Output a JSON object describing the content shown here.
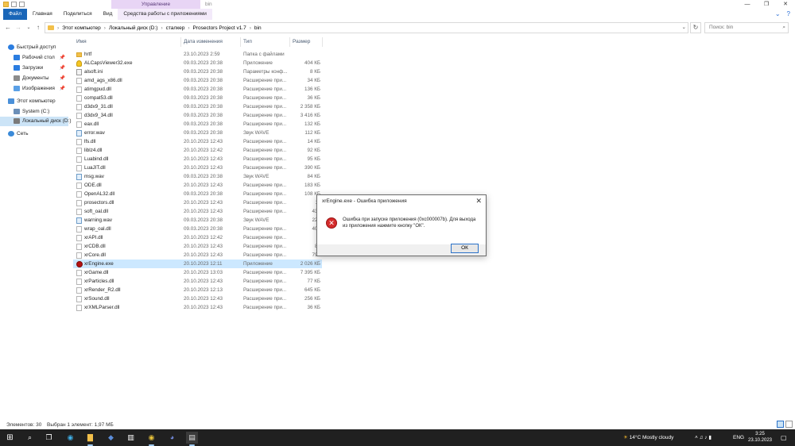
{
  "window": {
    "title": "bin",
    "context_tab": "Управление",
    "controls": [
      "—",
      "❐",
      "✕"
    ]
  },
  "ribbon": {
    "tabs": [
      "Файл",
      "Главная",
      "Поделиться",
      "Вид",
      "Средства работы с приложениями"
    ],
    "right_icons": [
      "chevron-down-icon",
      "help-icon"
    ]
  },
  "address": {
    "path": [
      "Этот компьютер",
      "Локальный диск (D:)",
      "сталкер",
      "Prosectors Project v1.7",
      "bin"
    ],
    "search_placeholder": "Поиск: bin"
  },
  "sidebar": {
    "items": [
      {
        "label": "Быстрый доступ",
        "icon": "star-icon",
        "color": "#2b7de0",
        "pinned": false,
        "indent": 0
      },
      {
        "label": "Рабочий стол",
        "icon": "desktop-icon",
        "color": "#2b7de0",
        "pinned": true,
        "indent": 1
      },
      {
        "label": "Загрузки",
        "icon": "download-icon",
        "color": "#2b7de0",
        "pinned": true,
        "indent": 1
      },
      {
        "label": "Документы",
        "icon": "documents-icon",
        "color": "#8c8c8c",
        "pinned": true,
        "indent": 1
      },
      {
        "label": "Изображения",
        "icon": "pictures-icon",
        "color": "#5aa0e6",
        "pinned": true,
        "indent": 1
      },
      {
        "label": "Этот компьютер",
        "icon": "computer-icon",
        "color": "#4a90d9",
        "pinned": false,
        "indent": 0
      },
      {
        "label": "System (C:)",
        "icon": "drive-icon",
        "color": "#6b8fb8",
        "pinned": false,
        "indent": 1
      },
      {
        "label": "Локальный диск (D:)",
        "icon": "drive-icon",
        "color": "#7a7a7a",
        "pinned": false,
        "indent": 1
      },
      {
        "label": "Сеть",
        "icon": "network-icon",
        "color": "#3b8ad8",
        "pinned": false,
        "indent": 0
      }
    ]
  },
  "columns": {
    "name": "Имя",
    "date": "Дата изменения",
    "type": "Тип",
    "size": "Размер"
  },
  "files": [
    {
      "name": "hrtf",
      "date": "23.10.2023 2:59",
      "type": "Папка с файлами",
      "size": "",
      "icon": "folder"
    },
    {
      "name": "ALCapsViewer32.exe",
      "date": "09.03.2023 20:38",
      "type": "Приложение",
      "size": "404 КБ",
      "icon": "yellow"
    },
    {
      "name": "alsoft.ini",
      "date": "09.03.2023 20:38",
      "type": "Параметры конф...",
      "size": "8 КБ",
      "icon": "ini"
    },
    {
      "name": "amd_ags_x86.dll",
      "date": "09.03.2023 20:38",
      "type": "Расширение при...",
      "size": "34 КБ",
      "icon": "dll"
    },
    {
      "name": "atimgpud.dll",
      "date": "09.03.2023 20:38",
      "type": "Расширение при...",
      "size": "136 КБ",
      "icon": "dll"
    },
    {
      "name": "compat53.dll",
      "date": "09.03.2023 20:38",
      "type": "Расширение при...",
      "size": "36 КБ",
      "icon": "dll"
    },
    {
      "name": "d3dx9_31.dll",
      "date": "09.03.2023 20:38",
      "type": "Расширение при...",
      "size": "2 358 КБ",
      "icon": "dll"
    },
    {
      "name": "d3dx9_34.dll",
      "date": "09.03.2023 20:38",
      "type": "Расширение при...",
      "size": "3 416 КБ",
      "icon": "dll"
    },
    {
      "name": "eax.dll",
      "date": "09.03.2023 20:38",
      "type": "Расширение при...",
      "size": "132 КБ",
      "icon": "dll"
    },
    {
      "name": "error.wav",
      "date": "09.03.2023 20:38",
      "type": "Звук WAVE",
      "size": "112 КБ",
      "icon": "wav"
    },
    {
      "name": "lfs.dll",
      "date": "20.10.2023 12:43",
      "type": "Расширение при...",
      "size": "14 КБ",
      "icon": "dll"
    },
    {
      "name": "liblz4.dll",
      "date": "20.10.2023 12:42",
      "type": "Расширение при...",
      "size": "92 КБ",
      "icon": "dll"
    },
    {
      "name": "Luabind.dll",
      "date": "20.10.2023 12:43",
      "type": "Расширение при...",
      "size": "95 КБ",
      "icon": "dll"
    },
    {
      "name": "LuaJIT.dll",
      "date": "20.10.2023 12:43",
      "type": "Расширение при...",
      "size": "390 КБ",
      "icon": "dll"
    },
    {
      "name": "msg.wav",
      "date": "09.03.2023 20:38",
      "type": "Звук WAVE",
      "size": "84 КБ",
      "icon": "wav"
    },
    {
      "name": "ODE.dll",
      "date": "20.10.2023 12:43",
      "type": "Расширение при...",
      "size": "183 КБ",
      "icon": "dll"
    },
    {
      "name": "OpenAL32.dll",
      "date": "09.03.2023 20:38",
      "type": "Расширение при...",
      "size": "108 КБ",
      "icon": "dll"
    },
    {
      "name": "prosectors.dll",
      "date": "20.10.2023 12:43",
      "type": "Расширение при...",
      "size": "11",
      "icon": "dll"
    },
    {
      "name": "soft_oal.dll",
      "date": "20.10.2023 12:43",
      "type": "Расширение при...",
      "size": "435",
      "icon": "dll"
    },
    {
      "name": "warning.wav",
      "date": "09.03.2023 20:38",
      "type": "Звук WAVE",
      "size": "223",
      "icon": "wav"
    },
    {
      "name": "wrap_oal.dll",
      "date": "09.03.2023 20:38",
      "type": "Расширение при...",
      "size": "404",
      "icon": "dll"
    },
    {
      "name": "xrAPI.dll",
      "date": "20.10.2023 12:42",
      "type": "Расширение при...",
      "size": "7",
      "icon": "dll"
    },
    {
      "name": "xrCDB.dll",
      "date": "20.10.2023 12:43",
      "type": "Расширение при...",
      "size": "84",
      "icon": "dll"
    },
    {
      "name": "xrCore.dll",
      "date": "20.10.2023 12:43",
      "type": "Расширение при...",
      "size": "794",
      "icon": "dll"
    },
    {
      "name": "xrEngine.exe",
      "date": "20.10.2023 12:11",
      "type": "Приложение",
      "size": "2 026 КБ",
      "icon": "red",
      "selected": true
    },
    {
      "name": "xrGame.dll",
      "date": "20.10.2023 13:03",
      "type": "Расширение при...",
      "size": "7 395 КБ",
      "icon": "dll"
    },
    {
      "name": "xrParticles.dll",
      "date": "20.10.2023 12:43",
      "type": "Расширение при...",
      "size": "77 КБ",
      "icon": "dll"
    },
    {
      "name": "xrRender_R2.dll",
      "date": "20.10.2023 12:13",
      "type": "Расширение при...",
      "size": "645 КБ",
      "icon": "dll"
    },
    {
      "name": "xrSound.dll",
      "date": "20.10.2023 12:43",
      "type": "Расширение при...",
      "size": "256 КБ",
      "icon": "dll"
    },
    {
      "name": "xrXMLParser.dll",
      "date": "20.10.2023 12:43",
      "type": "Расширение при...",
      "size": "36 КБ",
      "icon": "dll"
    }
  ],
  "dialog": {
    "title": "xrEngine.exe - Ошибка приложения",
    "message": "Ошибка при запуске приложения (0xc000007b). Для выхода из приложения нажмите кнопку \"ОК\".",
    "button": "ОК",
    "icon": "error-icon"
  },
  "status": {
    "count": "Элементов: 30",
    "selection": "Выбран 1 элемент: 1,97 МБ"
  },
  "taskbar": {
    "weather": "14°C  Mostly cloudy",
    "lang": "ENG",
    "time": "3:25",
    "date": "23.10.2023",
    "apps": [
      "start-icon",
      "search-icon",
      "task-view-icon",
      "edge-icon",
      "explorer-icon",
      "app-icon",
      "app-icon",
      "chrome-icon",
      "discord-icon",
      "window-icon"
    ]
  },
  "colors": {
    "accent": "#1a66b8",
    "selection": "#cce8ff",
    "context_tab": "#e8d5f5",
    "error": "#d42b2b",
    "taskbar": "#202020"
  }
}
